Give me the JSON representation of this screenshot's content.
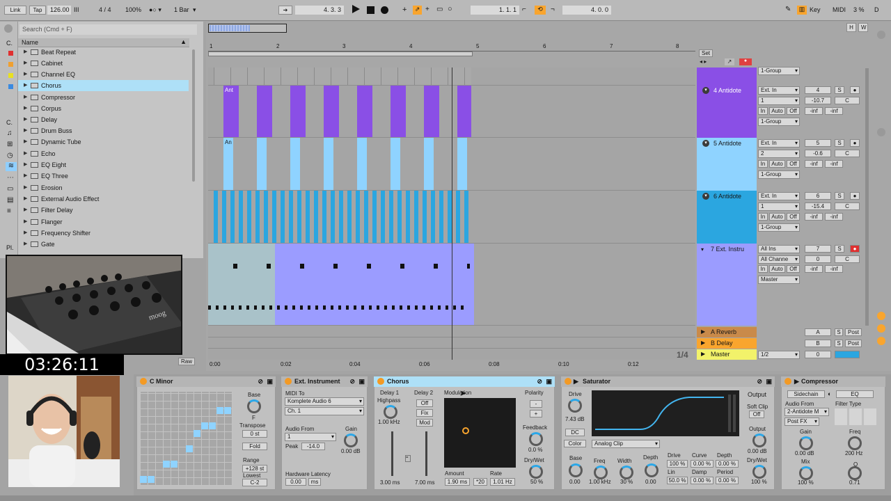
{
  "transport": {
    "link": "Link",
    "tap": "Tap",
    "tempo": "126.00",
    "sig_icon": "III",
    "meter": "4 / 4",
    "zoom": "100%",
    "metro": "1 Bar",
    "pos": "4.   3.   3",
    "loop_start": "1.   1.   1",
    "loop_len": "4.   0.   0",
    "key": "Key",
    "midi": "MIDI",
    "cpu": "3 %",
    "d": "D"
  },
  "browser": {
    "search_placeholder": "Search (Cmd + F)",
    "col_name": "Name",
    "items": [
      "Beat Repeat",
      "Cabinet",
      "Channel EQ",
      "Chorus",
      "Compressor",
      "Corpus",
      "Delay",
      "Drum Buss",
      "Dynamic Tube",
      "Echo",
      "EQ Eight",
      "EQ Three",
      "Erosion",
      "External Audio Effect",
      "Filter Delay",
      "Flanger",
      "Frequency Shifter",
      "Gate"
    ],
    "selected": "Chorus",
    "side_c": "C.",
    "side_pl": "Pl.",
    "raw": "Raw"
  },
  "overlay": {
    "timer": "03:26:11"
  },
  "arrangement": {
    "bars": [
      "1",
      "2",
      "3",
      "4",
      "5",
      "6",
      "7",
      "8"
    ],
    "times": [
      "0:00",
      "0:02",
      "0:04",
      "0:06",
      "0:08",
      "0:10",
      "0:12"
    ],
    "zoom_label": "1/4",
    "hw": [
      "H",
      "W"
    ],
    "set": "Set",
    "clip_ant": "Ant",
    "clip_an": "An"
  },
  "tracks": [
    {
      "name": "",
      "in": "",
      "ch": "",
      "mon": "",
      "out": "1-Group",
      "num": "",
      "vol": "",
      "pan": ""
    },
    {
      "name": "4 Antidote",
      "in": "Ext. In",
      "ch": "1",
      "mon": "Off",
      "out": "1-Group",
      "num": "4",
      "vol": "-10.7",
      "pan": "C",
      "sends": "-inf"
    },
    {
      "name": "5 Antidote",
      "in": "Ext. In",
      "ch": "2",
      "mon": "Off",
      "out": "1-Group",
      "num": "5",
      "vol": "-0.6",
      "pan": "C",
      "sends": "-inf"
    },
    {
      "name": "6 Antidote",
      "in": "Ext. In",
      "ch": "1",
      "mon": "Off",
      "out": "1-Group",
      "num": "6",
      "vol": "-15.4",
      "pan": "C",
      "sends": "-inf"
    },
    {
      "name": "7 Ext. Instru",
      "in": "All Ins",
      "ch": "All Channe",
      "mon": "Off",
      "out": "Master",
      "num": "7",
      "vol": "0",
      "pan": "C",
      "sends": "-inf"
    }
  ],
  "returns": [
    {
      "name": "A Reverb",
      "letter": "A"
    },
    {
      "name": "B Delay",
      "letter": "B"
    },
    {
      "name": "Master",
      "letter": "0",
      "io": "1/2"
    }
  ],
  "mix_labels": {
    "in": "In",
    "auto": "Auto",
    "off": "Off",
    "s": "S",
    "post": "Post"
  },
  "devices": {
    "cminor": {
      "title": "C Minor",
      "base": "Base",
      "transpose": "Transpose",
      "transpose_val": "0 st",
      "fold": "Fold",
      "range": "Range",
      "range_val": "+128 st",
      "lowest": "Lowest",
      "lowest_val": "C-2",
      "f": "F"
    },
    "extinst": {
      "title": "Ext. Instrument",
      "midi_to": "MIDI To",
      "midi_dev": "Komplete Audio 6",
      "midi_ch": "Ch. 1",
      "audio_from": "Audio From",
      "audio_in": "1",
      "gain": "Gain",
      "gain_val": "0.00 dB",
      "peak": "Peak",
      "peak_val": "-14.0",
      "latency": "Hardware Latency",
      "lat_val": "0.00",
      "lat_unit": "ms"
    },
    "chorus": {
      "title": "Chorus",
      "d1": "Delay 1",
      "hp": "Highpass",
      "hp_val": "1.00 kHz",
      "d2": "Delay 2",
      "off": "Off",
      "fix": "Fix",
      "mod": "Mod",
      "modulation": "Modulation",
      "amount": "Amount",
      "amount_val": "1.90 ms",
      "x20": "*20",
      "rate": "Rate",
      "rate_val": "1.01 Hz",
      "polarity": "Polarity",
      "minus": "-",
      "plus": "+",
      "feedback": "Feedback",
      "fb_val": "0.0 %",
      "drywet": "Dry/Wet",
      "dw_val": "50 %",
      "d1_val": "3.00 ms",
      "d2_val": "7.00 ms"
    },
    "saturator": {
      "title": "Saturator",
      "drive": "Drive",
      "drive_val": "7.43 dB",
      "dc": "DC",
      "color": "Color",
      "type": "Analog Clip",
      "base": "Base",
      "base_val": "0.00",
      "freq": "Freq",
      "freq_val": "1.00 kHz",
      "width": "Width",
      "width_val": "30 %",
      "depth": "Depth",
      "depth_val": "0.00",
      "drive2": "Drive",
      "drive2_val": "100 %",
      "curve": "Curve",
      "curve_val": "0.00 %",
      "depth2": "Depth",
      "depth2_val": "0.00 %",
      "lin": "Lin",
      "lin_val": "50.0 %",
      "damp": "Damp",
      "damp_val": "0.00 %",
      "period": "Period",
      "period_val": "0.00 %",
      "output": "Output",
      "soft_clip": "Soft Clip",
      "sc_val": "Off",
      "out_lbl": "Output",
      "out_val": "0.00 dB",
      "dw": "Dry/Wet",
      "dw_val": "100 %"
    },
    "compressor": {
      "title": "Compressor",
      "sidechain": "Sidechain",
      "eq": "EQ",
      "audio_from": "Audio From",
      "src": "2-Antidote M",
      "pos": "Post FX",
      "gain": "Gain",
      "gain_val": "0.00 dB",
      "mix": "Mix",
      "mix_val": "100 %",
      "filter_type": "Filter Type",
      "freq": "Freq",
      "freq_val": "200 Hz",
      "q": "Q",
      "q_val": "0.71"
    }
  },
  "colors": {
    "purple": "#8a4fe6",
    "lightblue": "#8fd3ff",
    "cyan": "#2ba6e0",
    "lavender": "#9b9cff",
    "orange": "#f9a52e"
  }
}
